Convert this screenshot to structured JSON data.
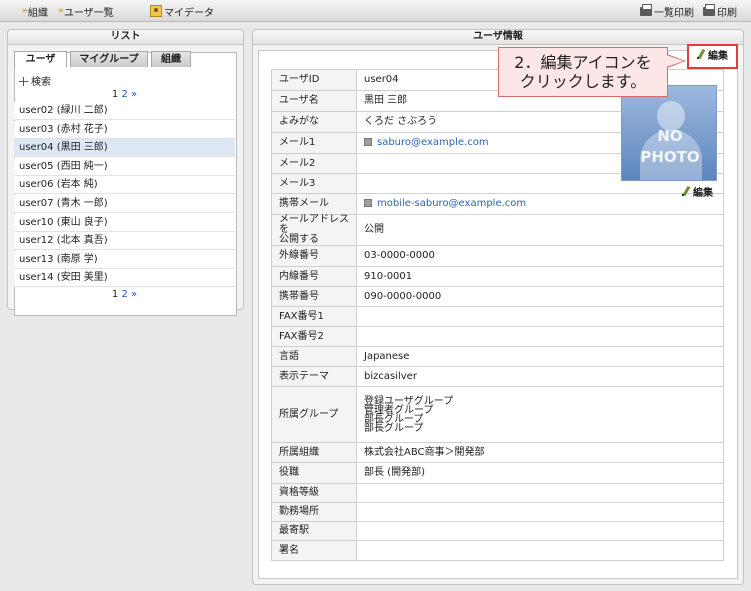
{
  "toolbar": {
    "crumb_org": "組織",
    "crumb_users": "ユーザ一覧",
    "mydata": "マイデータ",
    "print_list": "一覧印刷",
    "print": "印刷"
  },
  "list_panel": {
    "title": "リスト",
    "tabs": [
      "ユーザ",
      "マイグループ",
      "組織"
    ],
    "search_label": "検索",
    "pager_current": "1",
    "pager_next": "2",
    "pager_arrow": "»",
    "rows": [
      "user02 (緑川 二郎)",
      "user03 (赤村 花子)",
      "user04 (黒田 三郎)",
      "user05 (西田 純一)",
      "user06 (岩本 純)",
      "user07 (青木 一郎)",
      "user10 (東山 良子)",
      "user12 (北本 真吾)",
      "user13 (南原 学)",
      "user14 (安田 美里)"
    ],
    "selected_index": 2
  },
  "info_panel": {
    "title": "ユーザ情報",
    "edit_label": "編集",
    "photo_edit_label": "編集",
    "nophoto_line1": "NO",
    "nophoto_line2": "PHOTO",
    "fields": {
      "user_id": {
        "label": "ユーザID",
        "value": "user04"
      },
      "user_name": {
        "label": "ユーザ名",
        "value": "黒田 三郎"
      },
      "yomigana": {
        "label": "よみがな",
        "value": "くろだ さぶろう"
      },
      "mail1": {
        "label": "メール1",
        "value": "saburo@example.com"
      },
      "mail2": {
        "label": "メール2",
        "value": ""
      },
      "mail3": {
        "label": "メール3",
        "value": ""
      },
      "mobile_mail": {
        "label": "携帯メール",
        "value": "mobile-saburo@example.com"
      },
      "publish_mail_l1": "メールアドレスを",
      "publish_mail_l2": "公開する",
      "publish_mail_value": "公開",
      "ext_phone": {
        "label": "外線番号",
        "value": "03-0000-0000"
      },
      "int_phone": {
        "label": "内線番号",
        "value": "910-0001"
      },
      "mobile_phone": {
        "label": "携帯番号",
        "value": "090-0000-0000"
      },
      "fax1": {
        "label": "FAX番号1",
        "value": ""
      },
      "fax2": {
        "label": "FAX番号2",
        "value": ""
      },
      "language": {
        "label": "言語",
        "value": "Japanese"
      },
      "theme": {
        "label": "表示テーマ",
        "value": "bizcasilver"
      },
      "groups_label": "所属グループ",
      "groups": [
        "登録ユーザグループ",
        "管理者グループ",
        "部長グループ",
        "部長グループ"
      ],
      "org": {
        "label": "所属組織",
        "value": "株式会社ABC商事＞開発部"
      },
      "position": {
        "label": "役職",
        "value": "部長 (開発部)"
      },
      "qualification": {
        "label": "資格等級",
        "value": ""
      },
      "workplace": {
        "label": "勤務場所",
        "value": ""
      },
      "nearest_station": {
        "label": "最寄駅",
        "value": ""
      },
      "signature": {
        "label": "署名",
        "value": ""
      }
    }
  },
  "callout": {
    "line1": "2．編集アイコンを",
    "line2": "クリックします。",
    "highlight_color": "#e03c3c"
  }
}
